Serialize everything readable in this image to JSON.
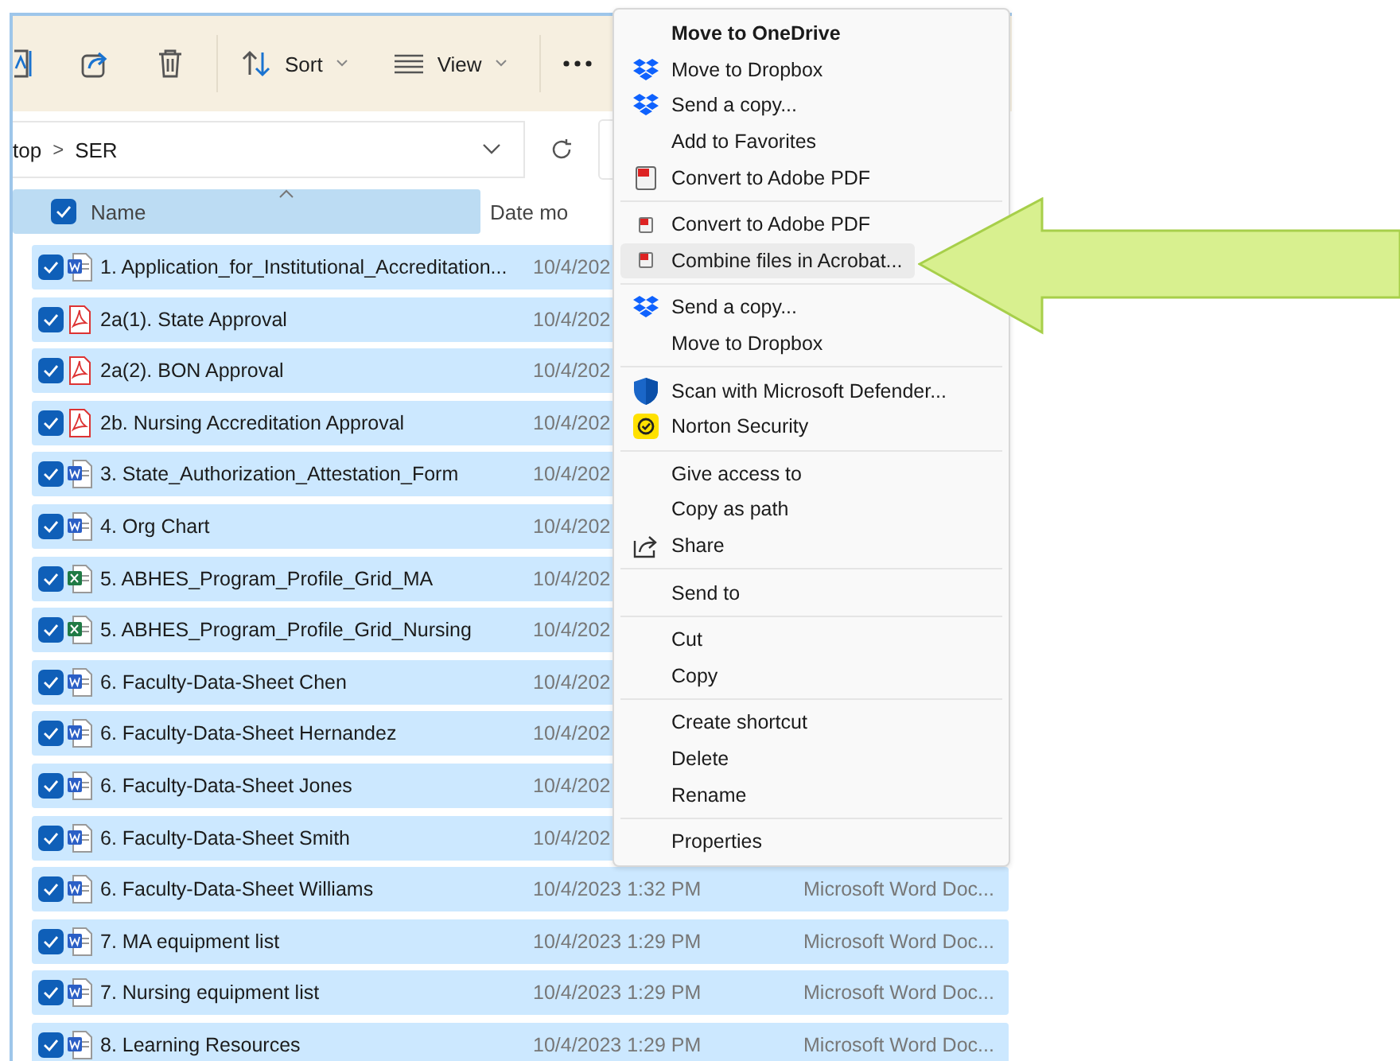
{
  "toolbar": {
    "buttons": [
      {
        "kind": "cut"
      },
      {
        "kind": "share"
      },
      {
        "kind": "delete"
      },
      {
        "kind": "sort",
        "label": "Sort"
      },
      {
        "kind": "view",
        "label": "View"
      },
      {
        "kind": "more"
      }
    ]
  },
  "address": {
    "crumbs": [
      "top",
      "SER"
    ],
    "separator": ">"
  },
  "header": {
    "checked": true,
    "name": "Name",
    "date": "Date mo"
  },
  "rows": [
    {
      "kind": "word",
      "name": "1. Application_for_Institutional_Accreditation...",
      "date": "10/4/202",
      "checked": true,
      "selected": true
    },
    {
      "kind": "pdf",
      "name": "2a(1). State Approval",
      "date": "10/4/202",
      "checked": true,
      "selected": true
    },
    {
      "kind": "pdf",
      "name": "2a(2). BON Approval",
      "date": "10/4/202",
      "checked": true,
      "selected": true
    },
    {
      "kind": "pdf",
      "name": "2b. Nursing Accreditation Approval",
      "date": "10/4/202",
      "checked": true,
      "selected": true
    },
    {
      "kind": "word",
      "name": "3. State_Authorization_Attestation_Form",
      "date": "10/4/202",
      "checked": true,
      "selected": true
    },
    {
      "kind": "word",
      "name": "4. Org Chart",
      "date": "10/4/202",
      "checked": true,
      "selected": true
    },
    {
      "kind": "excel",
      "name": "5. ABHES_Program_Profile_Grid_MA",
      "date": "10/4/202",
      "checked": true,
      "selected": true
    },
    {
      "kind": "excel",
      "name": "5. ABHES_Program_Profile_Grid_Nursing",
      "date": "10/4/202",
      "checked": true,
      "selected": true
    },
    {
      "kind": "word",
      "name": "6. Faculty-Data-Sheet Chen",
      "date": "10/4/202",
      "checked": true,
      "selected": true
    },
    {
      "kind": "word",
      "name": "6. Faculty-Data-Sheet Hernandez",
      "date": "10/4/202",
      "checked": true,
      "selected": true
    },
    {
      "kind": "word",
      "name": "6. Faculty-Data-Sheet Jones",
      "date": "10/4/202",
      "checked": true,
      "selected": true
    },
    {
      "kind": "word",
      "name": "6. Faculty-Data-Sheet Smith",
      "date": "10/4/202",
      "checked": true,
      "selected": true
    },
    {
      "kind": "word",
      "name": "6. Faculty-Data-Sheet Williams",
      "date": "10/4/2023 1:32 PM",
      "type": "Microsoft Word Doc...",
      "checked": true,
      "selected": true
    },
    {
      "kind": "word",
      "name": "7. MA equipment list",
      "date": "10/4/2023 1:29 PM",
      "type": "Microsoft Word Doc...",
      "checked": true,
      "selected": true
    },
    {
      "kind": "word",
      "name": "7. Nursing equipment list",
      "date": "10/4/2023 1:29 PM",
      "type": "Microsoft Word Doc...",
      "checked": true,
      "selected": true
    },
    {
      "kind": "word",
      "name": "8. Learning Resources",
      "date": "10/4/2023 1:29 PM",
      "type": "Microsoft Word Doc...",
      "checked": true,
      "selected": true
    }
  ],
  "context_menu": {
    "groups": [
      [
        {
          "kind": "bold",
          "label": "Move to OneDrive",
          "selected": false
        },
        {
          "kind": "dropbox",
          "label": "Move to Dropbox",
          "selected": false
        },
        {
          "kind": "dropbox",
          "label": "Send a copy...",
          "selected": false
        },
        {
          "kind": "plain",
          "label": "Add to Favorites",
          "selected": false
        },
        {
          "kind": "pdf",
          "label": "Convert to Adobe PDF",
          "selected": false
        }
      ],
      [
        {
          "kind": "acrobat",
          "label": "Convert to Adobe PDF",
          "selected": false
        },
        {
          "kind": "acrobat",
          "label": "Combine files in Acrobat...",
          "selected": true
        }
      ],
      [
        {
          "kind": "dropbox",
          "label": "Send a copy...",
          "selected": false
        },
        {
          "kind": "plain",
          "label": "Move to Dropbox",
          "selected": false
        }
      ],
      [
        {
          "kind": "defender",
          "label": "Scan with Microsoft Defender...",
          "selected": false
        },
        {
          "kind": "norton",
          "label": "Norton Security",
          "selected": false
        }
      ],
      [
        {
          "kind": "plain",
          "label": "Give access to",
          "selected": false
        },
        {
          "kind": "plain",
          "label": "Copy as path",
          "selected": false
        },
        {
          "kind": "share",
          "label": "Share",
          "selected": false
        }
      ],
      [
        {
          "kind": "plain",
          "label": "Send to",
          "selected": false
        }
      ],
      [
        {
          "kind": "plain",
          "label": "Cut",
          "selected": false
        },
        {
          "kind": "plain",
          "label": "Copy",
          "selected": false
        }
      ],
      [
        {
          "kind": "plain",
          "label": "Create shortcut",
          "selected": false
        },
        {
          "kind": "plain",
          "label": "Delete",
          "selected": false
        },
        {
          "kind": "plain",
          "label": "Rename",
          "selected": false
        }
      ],
      [
        {
          "kind": "plain",
          "label": "Properties",
          "selected": false
        }
      ]
    ]
  }
}
